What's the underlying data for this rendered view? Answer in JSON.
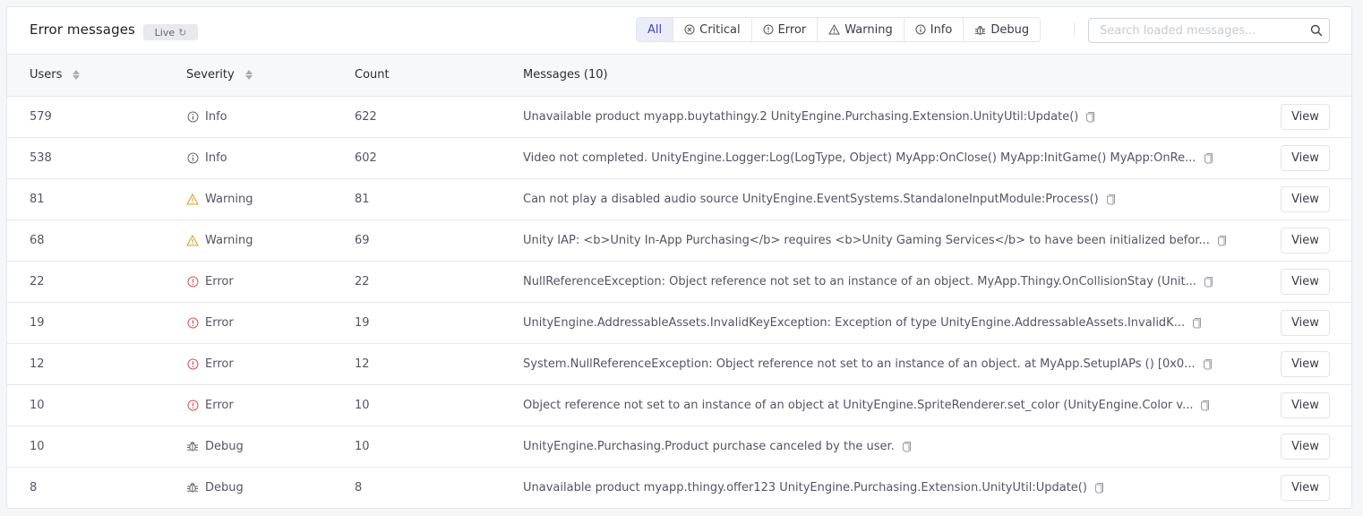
{
  "header": {
    "title": "Error messages",
    "live_badge": "Live",
    "filters": [
      {
        "label": "All",
        "icon": "none",
        "active": true
      },
      {
        "label": "Critical",
        "icon": "x-circle-icon",
        "active": false
      },
      {
        "label": "Error",
        "icon": "alert-circle-icon",
        "active": false
      },
      {
        "label": "Warning",
        "icon": "warning-triangle-icon",
        "active": false
      },
      {
        "label": "Info",
        "icon": "info-circle-icon",
        "active": false
      },
      {
        "label": "Debug",
        "icon": "bug-icon",
        "active": false
      }
    ],
    "search_placeholder": "Search loaded messages...",
    "search_value": ""
  },
  "colors": {
    "accent": "#3d47c7",
    "warning": "#d9a22b",
    "error": "#d9534f",
    "info": "#666666",
    "debug": "#666666"
  },
  "table": {
    "columns": {
      "users": "Users",
      "severity": "Severity",
      "count": "Count",
      "messages": "Messages (10)"
    },
    "action_label": "View",
    "rows": [
      {
        "users": "579",
        "severity": "Info",
        "count": "622",
        "message": "Unavailable product myapp.buytathingy.2 UnityEngine.Purchasing.Extension.UnityUtil:Update()"
      },
      {
        "users": "538",
        "severity": "Info",
        "count": "602",
        "message": "Video not completed. UnityEngine.Logger:Log(LogType, Object) MyApp:OnClose() MyApp:InitGame() MyApp:OnRe..."
      },
      {
        "users": "81",
        "severity": "Warning",
        "count": "81",
        "message": "Can not play a disabled audio source UnityEngine.EventSystems.StandaloneInputModule:Process()"
      },
      {
        "users": "68",
        "severity": "Warning",
        "count": "69",
        "message": "Unity IAP: <b>Unity In-App Purchasing</b> requires <b>Unity Gaming Services</b> to have been initialized befor..."
      },
      {
        "users": "22",
        "severity": "Error",
        "count": "22",
        "message": "NullReferenceException: Object reference not set to an instance of an object. MyApp.Thingy.OnCollisionStay (Unit..."
      },
      {
        "users": "19",
        "severity": "Error",
        "count": "19",
        "message": "UnityEngine.AddressableAssets.InvalidKeyException: Exception of type UnityEngine.AddressableAssets.InvalidK..."
      },
      {
        "users": "12",
        "severity": "Error",
        "count": "12",
        "message": "System.NullReferenceException: Object reference not set to an instance of an object. at MyApp.SetupIAPs () [0x0..."
      },
      {
        "users": "10",
        "severity": "Error",
        "count": "10",
        "message": "Object reference not set to an instance of an object at UnityEngine.SpriteRenderer.set_color (UnityEngine.Color v..."
      },
      {
        "users": "10",
        "severity": "Debug",
        "count": "10",
        "message": "UnityEngine.Purchasing.Product purchase canceled by the user."
      },
      {
        "users": "8",
        "severity": "Debug",
        "count": "8",
        "message": "Unavailable product myapp.thingy.offer123 UnityEngine.Purchasing.Extension.UnityUtil:Update()"
      }
    ]
  }
}
